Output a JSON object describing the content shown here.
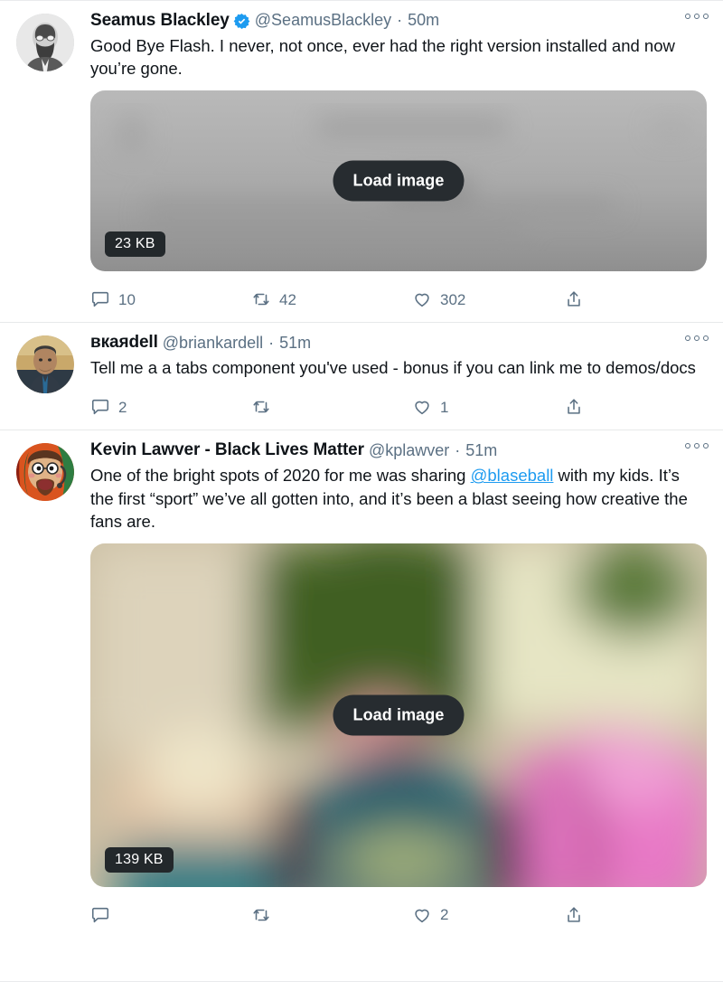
{
  "media_labels": {
    "load_image": "Load image"
  },
  "colors": {
    "link": "#1d9bf0",
    "verified": "#1d9bf0",
    "text": "#0f1419",
    "meta": "#5b7083",
    "divider": "#e7e9ea",
    "badge_bg": "#23282b"
  },
  "tweets": [
    {
      "display_name": "Seamus Blackley",
      "verified": true,
      "handle": "@SeamusBlackley",
      "separator": "·",
      "time": "50m",
      "text": "Good Bye Flash. I never, not once, ever had the right version installed and now you’re gone.",
      "media": {
        "type": "placeholder-gray",
        "size_label": "23 KB",
        "load_label": "Load image"
      },
      "actions": {
        "reply": "10",
        "retweet": "42",
        "like": "302",
        "share": ""
      }
    },
    {
      "display_name": "вкаяdell",
      "verified": false,
      "handle": "@briankardell",
      "separator": "·",
      "time": "51m",
      "text": "Tell me a a tabs component you've used - bonus if you can link me to demos/docs",
      "media": null,
      "actions": {
        "reply": "2",
        "retweet": "",
        "like": "1",
        "share": ""
      }
    },
    {
      "display_name": "Kevin Lawver - Black Lives Matter",
      "verified": false,
      "handle": "@kplawver",
      "separator": "·",
      "time": "51m",
      "text_before_mention": "One of the bright spots of 2020 for me was sharing ",
      "mention": "@blaseball",
      "text_after_mention": " with my kids. It’s the first “sport” we’ve all gotten into, and it’s been a blast seeing how creative the fans are.",
      "media": {
        "type": "placeholder-photo",
        "size_label": "139 KB",
        "load_label": "Load image"
      },
      "actions": {
        "reply": "",
        "retweet": "",
        "like": "2",
        "share": ""
      }
    }
  ]
}
